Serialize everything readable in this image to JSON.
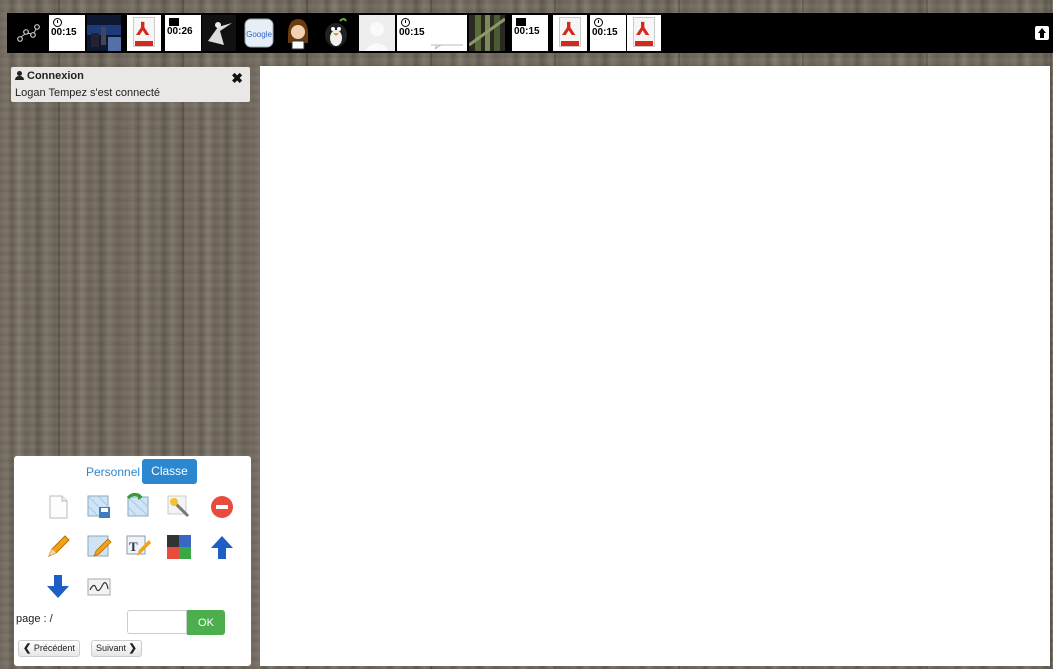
{
  "topbar": {
    "items": [
      {
        "kind": "timer",
        "icon": "clock-icon",
        "time": "00:15"
      },
      {
        "kind": "thumbnail",
        "icon": "video-thumbnail-icon"
      },
      {
        "kind": "pdf",
        "icon": "pdf-icon"
      },
      {
        "kind": "timer",
        "icon": "chat-icon",
        "time": "00:26"
      },
      {
        "kind": "thumbnail",
        "icon": "dancer-thumbnail-icon"
      },
      {
        "kind": "app",
        "icon": "google-icon",
        "text": "Google"
      },
      {
        "kind": "avatar",
        "icon": "girl-avatar-icon"
      },
      {
        "kind": "avatar",
        "icon": "mac-penguin-icon"
      },
      {
        "kind": "avatar",
        "icon": "blank-avatar-icon"
      },
      {
        "kind": "timer",
        "icon": "clock-icon",
        "time": "00:15"
      },
      {
        "kind": "thumbnail",
        "icon": "film-strip-icon"
      },
      {
        "kind": "timer",
        "icon": "image-icon",
        "time": "00:15"
      },
      {
        "kind": "pdf",
        "icon": "pdf-icon"
      },
      {
        "kind": "timer",
        "icon": "clock-icon",
        "time": "00:15"
      },
      {
        "kind": "pdf",
        "icon": "pdf-icon"
      }
    ]
  },
  "notification": {
    "title": "Connexion",
    "message": "Logan Tempez s'est connecté",
    "close_icon": "close-icon"
  },
  "tools": {
    "tabs": {
      "personal": "Personnel",
      "class": "Classe",
      "active": "Classe"
    },
    "icons": [
      "new-page-icon",
      "save-board-icon",
      "redo-board-icon",
      "magic-wand-icon",
      "stop-icon",
      "pencil-icon",
      "edit-board-icon",
      "text-tool-icon",
      "color-palette-icon",
      "arrow-up-icon",
      "arrow-down-icon",
      "signature-icon"
    ],
    "page_label": "page : /",
    "page_input_value": "",
    "ok_label": "OK",
    "prev_label": "Précédent",
    "next_label": "Suivant"
  },
  "colors": {
    "accent": "#2a87d0",
    "ok": "#4cae4c",
    "pdf_red": "#d42a1e"
  }
}
